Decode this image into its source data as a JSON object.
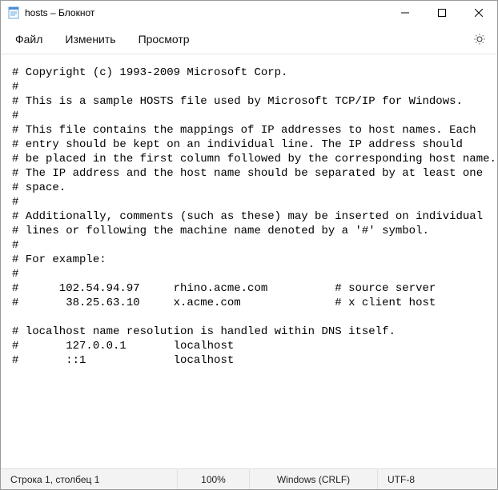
{
  "titlebar": {
    "title": "hosts – Блокнот"
  },
  "menu": {
    "file": "Файл",
    "edit": "Изменить",
    "view": "Просмотр"
  },
  "editor": {
    "content": "# Copyright (c) 1993-2009 Microsoft Corp.\n#\n# This is a sample HOSTS file used by Microsoft TCP/IP for Windows.\n#\n# This file contains the mappings of IP addresses to host names. Each\n# entry should be kept on an individual line. The IP address should\n# be placed in the first column followed by the corresponding host name.\n# The IP address and the host name should be separated by at least one\n# space.\n#\n# Additionally, comments (such as these) may be inserted on individual\n# lines or following the machine name denoted by a '#' symbol.\n#\n# For example:\n#\n#      102.54.94.97     rhino.acme.com          # source server\n#       38.25.63.10     x.acme.com              # x client host\n\n# localhost name resolution is handled within DNS itself.\n#\t127.0.0.1       localhost\n#\t::1             localhost"
  },
  "status": {
    "position": "Строка 1, столбец 1",
    "zoom": "100%",
    "line_ending": "Windows (CRLF)",
    "encoding": "UTF-8"
  }
}
